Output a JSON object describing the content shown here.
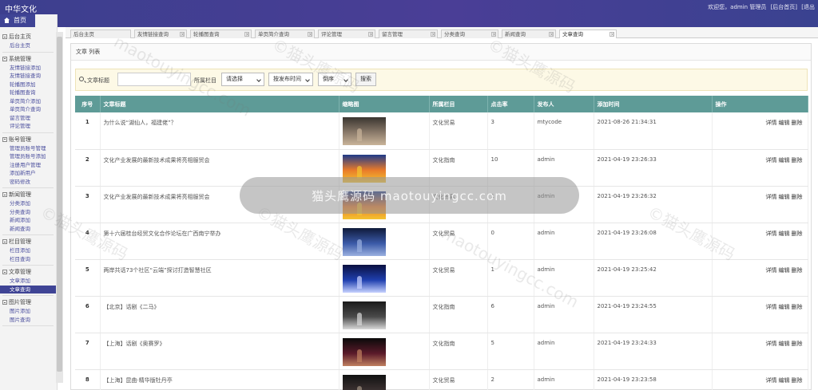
{
  "header": {
    "brand": "中华文化",
    "welcome": "欢迎您，admin 管理员",
    "links": [
      "[后台首页]",
      "[退出"
    ]
  },
  "sidebar": {
    "home_label": "首页",
    "groups": [
      {
        "title": "后台主页",
        "items": [
          "后台主页"
        ]
      },
      {
        "title": "系统管理",
        "items": [
          "友情链接添加",
          "友情链接查询",
          "轮播图添加",
          "轮播图查询",
          "单页简介添加",
          "单页简介查询",
          "留言管理",
          "评论管理"
        ]
      },
      {
        "title": "账号管理",
        "items": [
          "管理员账号管理",
          "管理员账号添加",
          "注册用户管理",
          "添加新用户",
          "密码修改"
        ]
      },
      {
        "title": "新闻管理",
        "items": [
          "分类添加",
          "分类查询",
          "新闻添加",
          "新闻查询"
        ]
      },
      {
        "title": "栏目管理",
        "items": [
          "栏目添加",
          "栏目查询"
        ]
      },
      {
        "title": "文章管理",
        "items": [
          "文章添加",
          "文章查询"
        ]
      },
      {
        "title": "图片管理",
        "items": [
          "图片添加",
          "图片查询"
        ]
      }
    ],
    "active_item": "文章查询"
  },
  "tabs": [
    {
      "label": "后台主页"
    },
    {
      "label": "友情链接查询"
    },
    {
      "label": "轮播图查询"
    },
    {
      "label": "单页简介查询"
    },
    {
      "label": "评论管理"
    },
    {
      "label": "留言管理"
    },
    {
      "label": "分类查询"
    },
    {
      "label": "新闻查询"
    },
    {
      "label": "文章查询"
    }
  ],
  "panel": {
    "title": "文章 列表",
    "search": {
      "title_label": "文章标题",
      "title_value": "",
      "column_label": "所属栏目",
      "column_select": "请选择",
      "sort_select": "按发布时间",
      "order_select": "倒序",
      "search_button": "搜索"
    }
  },
  "table": {
    "headers": [
      "序号",
      "文章标题",
      "缩略图",
      "所属栏目",
      "点击率",
      "发布人",
      "添加时间",
      "操作"
    ],
    "ops": [
      "详情",
      "编辑",
      "删除"
    ],
    "rows": [
      {
        "no": "1",
        "title": "为什么说“湖仙人，福建佬”？",
        "column": "文化贸易",
        "clicks": "3",
        "author": "mtycode",
        "time": "2021-08-26 21:34:31"
      },
      {
        "no": "2",
        "title": "文化产业发展的最新技术成果将亮相服贸会",
        "column": "文化指南",
        "clicks": "10",
        "author": "admin",
        "time": "2021-04-19 23:26:33"
      },
      {
        "no": "3",
        "title": "文化产业发展的最新技术成果将亮相服贸会",
        "column": "文化贸易",
        "clicks": "1",
        "author": "admin",
        "time": "2021-04-19 23:26:32"
      },
      {
        "no": "4",
        "title": "第十六届桂台经贸文化合作论坛在广西南宁举办",
        "column": "文化贸易",
        "clicks": "0",
        "author": "admin",
        "time": "2021-04-19 23:26:08"
      },
      {
        "no": "5",
        "title": "两岸共话73个社区“云端”探讨打造智慧社区",
        "column": "文化贸易",
        "clicks": "1",
        "author": "admin",
        "time": "2021-04-19 23:25:42"
      },
      {
        "no": "6",
        "title": "【北京】话剧《二马》",
        "column": "文化指南",
        "clicks": "6",
        "author": "admin",
        "time": "2021-04-19 23:24:55"
      },
      {
        "no": "7",
        "title": "【上海】话剧《奥赛罗》",
        "column": "文化指南",
        "clicks": "5",
        "author": "admin",
        "time": "2021-04-19 23:24:33"
      },
      {
        "no": "8",
        "title": "【上海】昆曲·精华版牡丹亭",
        "column": "文化贸易",
        "clicks": "2",
        "author": "admin",
        "time": "2021-04-19 23:23:58"
      }
    ]
  },
  "watermark": {
    "center_text": "猫头鹰源码 maotouyingcc.com",
    "diagonal_texts": [
      "©猫头鹰源码",
      "maotouyingcc.com"
    ]
  },
  "colors": {
    "header_bg": "#4a3e96",
    "table_header_bg": "#5e9b97",
    "search_bg": "#fdf9e6",
    "active_item_bg": "#3f4495"
  }
}
